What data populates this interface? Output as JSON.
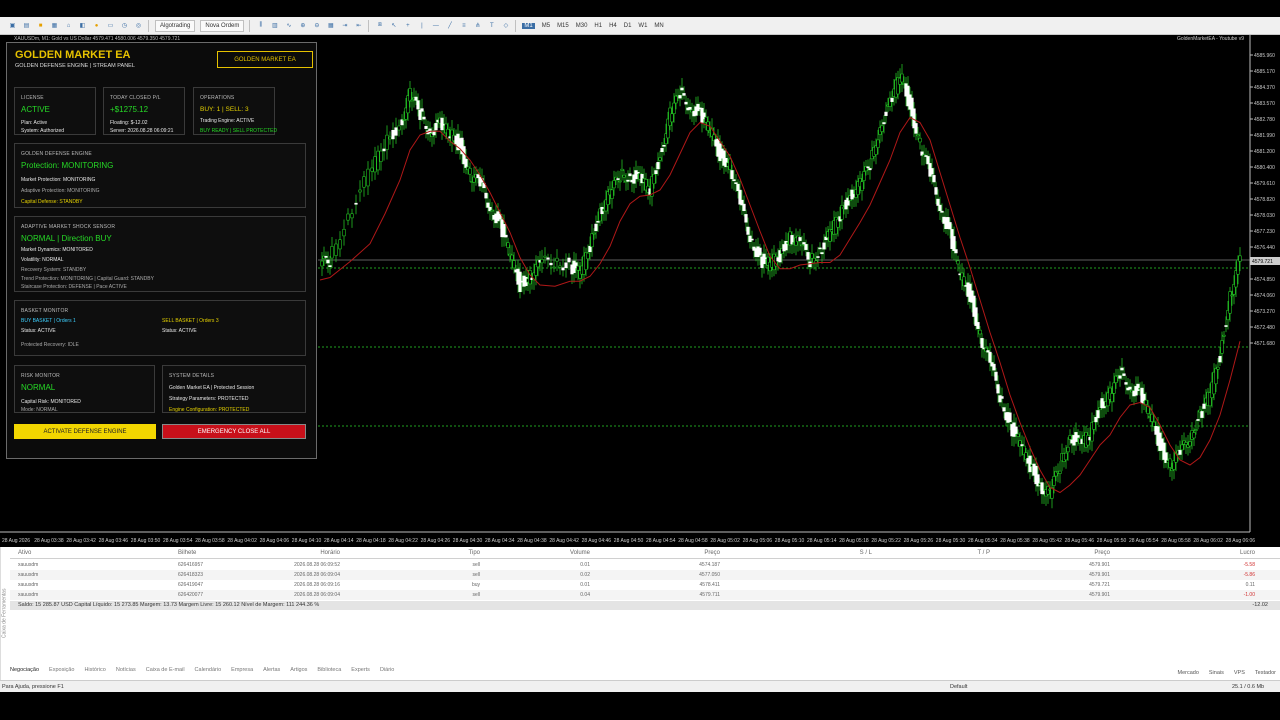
{
  "toolbar": {
    "algotrading": "Algotrading",
    "new_order": "Nova Ordem",
    "timeframes": [
      "M1",
      "M5",
      "M15",
      "M30",
      "H1",
      "H4",
      "D1",
      "W1",
      "MN"
    ],
    "active_tf": "M1"
  },
  "chart": {
    "title": "XAUUSDm, M1: Gold vs US Dollar  4579.471 4580.006 4579.350 4579.721",
    "indicator": "GoldenMarketEA - Youtube v9",
    "y_ticks": [
      "4585.960",
      "4585.170",
      "4584.370",
      "4583.570",
      "4582.780",
      "4581.990",
      "4581.200",
      "4580.400",
      "4579.610",
      "4578.820",
      "4578.030",
      "4577.230",
      "4576.440",
      "4575.650",
      "4574.850",
      "4574.060",
      "4573.270",
      "4572.480",
      "4571.680"
    ],
    "x_ticks": [
      "28 Aug 2026",
      "28 Aug 03:38",
      "28 Aug 03:42",
      "28 Aug 03:46",
      "28 Aug 03:50",
      "28 Aug 03:54",
      "28 Aug 03:58",
      "28 Aug 04:02",
      "28 Aug 04:06",
      "28 Aug 04:10",
      "28 Aug 04:14",
      "28 Aug 04:18",
      "28 Aug 04:22",
      "28 Aug 04:26",
      "28 Aug 04:30",
      "28 Aug 04:34",
      "28 Aug 04:38",
      "28 Aug 04:42",
      "28 Aug 04:46",
      "28 Aug 04:50",
      "28 Aug 04:54",
      "28 Aug 04:58",
      "28 Aug 05:02",
      "28 Aug 05:06",
      "28 Aug 05:10",
      "28 Aug 05:14",
      "28 Aug 05:18",
      "28 Aug 05:22",
      "28 Aug 05:26",
      "28 Aug 05:30",
      "28 Aug 05:34",
      "28 Aug 05:38",
      "28 Aug 05:42",
      "28 Aug 05:46",
      "28 Aug 05:50",
      "28 Aug 05:54",
      "28 Aug 05:58",
      "28 Aug 06:02",
      "28 Aug 06:06"
    ],
    "price_label": "4579.721",
    "bid_label": "4579.130"
  },
  "panel": {
    "title": "GOLDEN MARKET EA",
    "subtitle": "GOLDEN DEFENSE ENGINE | STREAM PANEL",
    "badge": "GOLDEN MARKET EA",
    "license": {
      "head": "LICENSE",
      "status": "ACTIVE",
      "plan": "Plan: Active",
      "system": "System: Authorized"
    },
    "pnl": {
      "head": "TODAY CLOSED P/L",
      "value": "+$1275.12",
      "floating": "Floating: $-12.02",
      "server": "Server: 2026.08.28 06:09:21"
    },
    "ops": {
      "head": "OPERATIONS",
      "value": "BUY: 1 | SELL: 3",
      "engine": "Trading Engine: ACTIVE",
      "ready": "BUY READY | SELL PROTECTED"
    },
    "defense": {
      "head": "GOLDEN DEFENSE ENGINE",
      "status": "Protection: MONITORING",
      "l1": "Market Protection: MONITORING",
      "l2": "Adaptive Protection: MONITORING",
      "l3": "Capital Defense: STANDBY"
    },
    "shock": {
      "head": "ADAPTIVE MARKET SHOCK SENSOR",
      "status": "NORMAL | Direction BUY",
      "l1": "Market Dynamics: MONITORED",
      "l2": "Volatility: NORMAL",
      "l3": "Recovery System: STANDBY",
      "l4": "Trend Protection: MONITORING | Capital Guard: STANDBY",
      "l5": "Staircase Protection: DEFENSE | Pace ACTIVE"
    },
    "basket": {
      "head": "BASKET MONITOR",
      "buy": "BUY BASKET | Orders 1",
      "buy_status": "Status: ACTIVE",
      "sell": "SELL BASKET | Orders 3",
      "sell_status": "Status: ACTIVE",
      "recovery": "Protected Recovery: IDLE"
    },
    "risk": {
      "head": "RISK MONITOR",
      "status": "NORMAL",
      "l1": "Capital Risk: MONITORED",
      "l2": "Mode: NORMAL"
    },
    "sys": {
      "head": "SYSTEM DETAILS",
      "l1": "Golden Market EA | Protected Session",
      "l2": "Strategy Parameters: PROTECTED",
      "l3": "Engine Configuration: PROTECTED"
    },
    "btn_activate": "ACTIVATE DEFENSE ENGINE",
    "btn_close": "EMERGENCY CLOSE ALL"
  },
  "table": {
    "headers": [
      "Ativo",
      "Bilhete",
      "Horário",
      "Tipo",
      "Volume",
      "Preço",
      "S / L",
      "T / P",
      "Preço",
      "Lucro"
    ],
    "rows": [
      [
        "xauusdm",
        "626416957",
        "2026.08.28 06:09:52",
        "sell",
        "0.01",
        "4574.187",
        "",
        "",
        "4579.901",
        "-5.58"
      ],
      [
        "xauusdm",
        "626418323",
        "2026.08.28 06:09:04",
        "sell",
        "0.02",
        "4577.050",
        "",
        "",
        "4579.901",
        "-5.86"
      ],
      [
        "xauusdm",
        "626419047",
        "2026.08.28 06:09:16",
        "buy",
        "0.01",
        "4578.411",
        "",
        "",
        "4579.721",
        "0.11"
      ],
      [
        "xauusdm",
        "626420077",
        "2026.08.28 06:09:04",
        "sell",
        "0.04",
        "4579.711",
        "",
        "",
        "4579.901",
        "-1.00"
      ]
    ],
    "balance": "Saldo: 15 285.87 USD  Capital Líquido: 15 273.85  Margem: 13.73  Margem Livre: 15 260.12  Nível de Margem: 111 244.36 %",
    "total": "-12.02"
  },
  "tabs": [
    "Negociação",
    "Exposição",
    "Histórico",
    "Notícias",
    "Caixa de E-mail",
    "Calendário",
    "Empresa",
    "Alertas",
    "Artigos",
    "Biblioteca",
    "Experts",
    "Diário"
  ],
  "right_tabs": [
    "Mercado",
    "Sinais",
    "VPS",
    "Testador"
  ],
  "side_label": "Caixa de Ferramentas",
  "status": {
    "help": "Para Ajuda, pressione F1",
    "profile": "Default",
    "conn": "25.1 / 0.6 Mb"
  }
}
